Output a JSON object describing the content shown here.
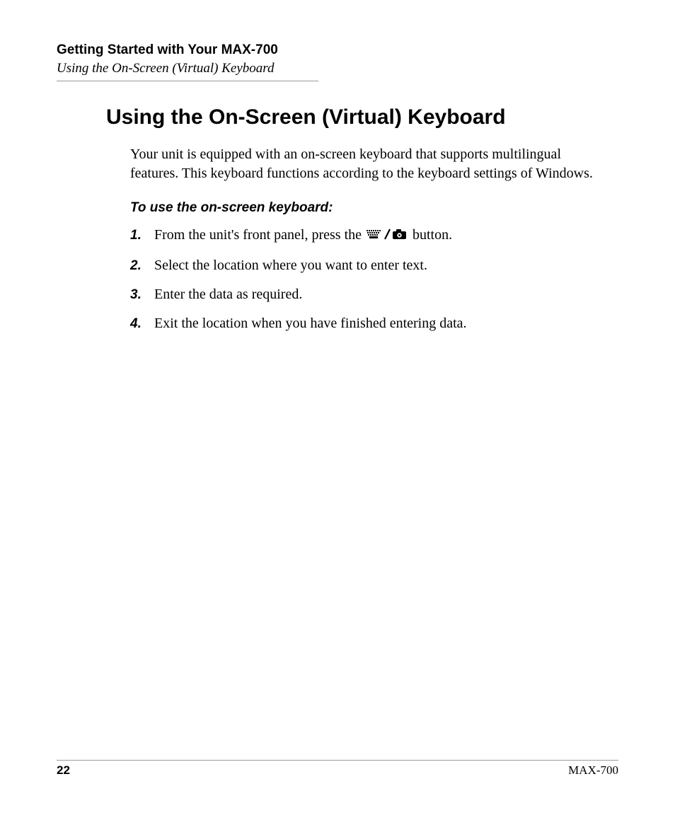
{
  "header": {
    "chapter": "Getting Started with Your MAX-700",
    "section": "Using the On-Screen (Virtual) Keyboard"
  },
  "title": "Using the On-Screen (Virtual) Keyboard",
  "intro": "Your unit is equipped with an on-screen keyboard that supports multilingual features. This keyboard functions according to the keyboard settings of Windows.",
  "subhead": "To use the on-screen keyboard:",
  "steps": [
    {
      "num": "1.",
      "before": "From the unit's front panel, press the ",
      "after": " button."
    },
    {
      "num": "2.",
      "text": "Select the location where you want to enter text."
    },
    {
      "num": "3.",
      "text": "Enter the data as required."
    },
    {
      "num": "4.",
      "text": "Exit the location when you have finished entering data."
    }
  ],
  "footer": {
    "page": "22",
    "model": "MAX-700"
  }
}
